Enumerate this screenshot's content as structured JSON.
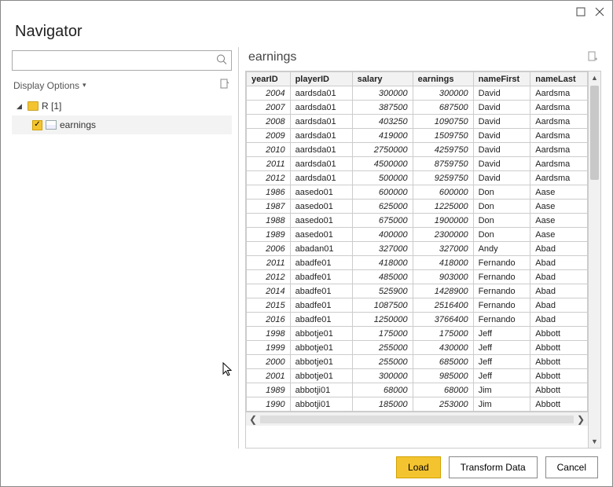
{
  "window": {
    "title": "Navigator"
  },
  "search": {
    "placeholder": ""
  },
  "displayOptions": {
    "label": "Display Options"
  },
  "tree": {
    "root": {
      "label": "R [1]"
    },
    "child": {
      "label": "earnings",
      "checked": true
    }
  },
  "preview": {
    "title": "earnings",
    "columns": [
      "yearID",
      "playerID",
      "salary",
      "earnings",
      "nameFirst",
      "nameLast"
    ]
  },
  "chart_data": {
    "type": "table",
    "columns": [
      "yearID",
      "playerID",
      "salary",
      "earnings",
      "nameFirst",
      "nameLast"
    ],
    "rows": [
      [
        2004,
        "aardsda01",
        300000,
        300000,
        "David",
        "Aardsma"
      ],
      [
        2007,
        "aardsda01",
        387500,
        687500,
        "David",
        "Aardsma"
      ],
      [
        2008,
        "aardsda01",
        403250,
        1090750,
        "David",
        "Aardsma"
      ],
      [
        2009,
        "aardsda01",
        419000,
        1509750,
        "David",
        "Aardsma"
      ],
      [
        2010,
        "aardsda01",
        2750000,
        4259750,
        "David",
        "Aardsma"
      ],
      [
        2011,
        "aardsda01",
        4500000,
        8759750,
        "David",
        "Aardsma"
      ],
      [
        2012,
        "aardsda01",
        500000,
        9259750,
        "David",
        "Aardsma"
      ],
      [
        1986,
        "aasedo01",
        600000,
        600000,
        "Don",
        "Aase"
      ],
      [
        1987,
        "aasedo01",
        625000,
        1225000,
        "Don",
        "Aase"
      ],
      [
        1988,
        "aasedo01",
        675000,
        1900000,
        "Don",
        "Aase"
      ],
      [
        1989,
        "aasedo01",
        400000,
        2300000,
        "Don",
        "Aase"
      ],
      [
        2006,
        "abadan01",
        327000,
        327000,
        "Andy",
        "Abad"
      ],
      [
        2011,
        "abadfe01",
        418000,
        418000,
        "Fernando",
        "Abad"
      ],
      [
        2012,
        "abadfe01",
        485000,
        903000,
        "Fernando",
        "Abad"
      ],
      [
        2014,
        "abadfe01",
        525900,
        1428900,
        "Fernando",
        "Abad"
      ],
      [
        2015,
        "abadfe01",
        1087500,
        2516400,
        "Fernando",
        "Abad"
      ],
      [
        2016,
        "abadfe01",
        1250000,
        3766400,
        "Fernando",
        "Abad"
      ],
      [
        1998,
        "abbotje01",
        175000,
        175000,
        "Jeff",
        "Abbott"
      ],
      [
        1999,
        "abbotje01",
        255000,
        430000,
        "Jeff",
        "Abbott"
      ],
      [
        2000,
        "abbotje01",
        255000,
        685000,
        "Jeff",
        "Abbott"
      ],
      [
        2001,
        "abbotje01",
        300000,
        985000,
        "Jeff",
        "Abbott"
      ],
      [
        1989,
        "abbotji01",
        68000,
        68000,
        "Jim",
        "Abbott"
      ],
      [
        1990,
        "abbotji01",
        185000,
        253000,
        "Jim",
        "Abbott"
      ]
    ]
  },
  "buttons": {
    "load": "Load",
    "transform": "Transform Data",
    "cancel": "Cancel"
  }
}
